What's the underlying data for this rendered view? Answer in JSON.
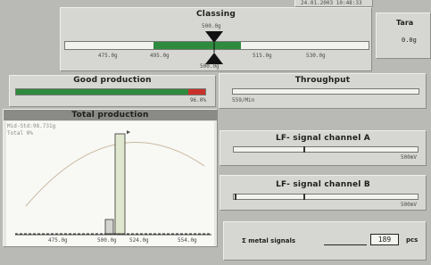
{
  "datetime": "24.01.2003 10:48:33",
  "classing": {
    "title": "Classing",
    "setpoint_top": "500.0g",
    "setpoint_bottom": "500.0g",
    "scale_labels": [
      "475.0g",
      "495.0g",
      "515.0g",
      "530.0g"
    ],
    "accept_band_pct": [
      29,
      58
    ]
  },
  "tara": {
    "label": "Tara",
    "value": "0.0g"
  },
  "good_production": {
    "title": "Good production",
    "value": "96.0%",
    "good_fraction": 0.91
  },
  "throughput": {
    "title": "Throughput",
    "value": "0.0",
    "unit": "559/Min"
  },
  "total_production": {
    "title": "Total production",
    "stat1": "Mid-Std:98.731g",
    "stat2": "Total 0%",
    "x_labels": [
      "475.0g",
      "500.0g",
      "524.0g",
      "554.0g"
    ],
    "peak_marker": "▶"
  },
  "lf_channel_a": {
    "title": "LF- signal channel A",
    "unit": "500mV",
    "level": 0.38
  },
  "lf_channel_b": {
    "title": "LF- signal channel B",
    "unit": "500mV",
    "level": 0.38
  },
  "metal": {
    "label": "Σ metal signals",
    "value": "189",
    "unit": "pcs"
  },
  "colors": {
    "green": "#2e8b3e",
    "red": "#c8312b",
    "panel": "#d6d7d2",
    "background": "#b9bab5"
  }
}
